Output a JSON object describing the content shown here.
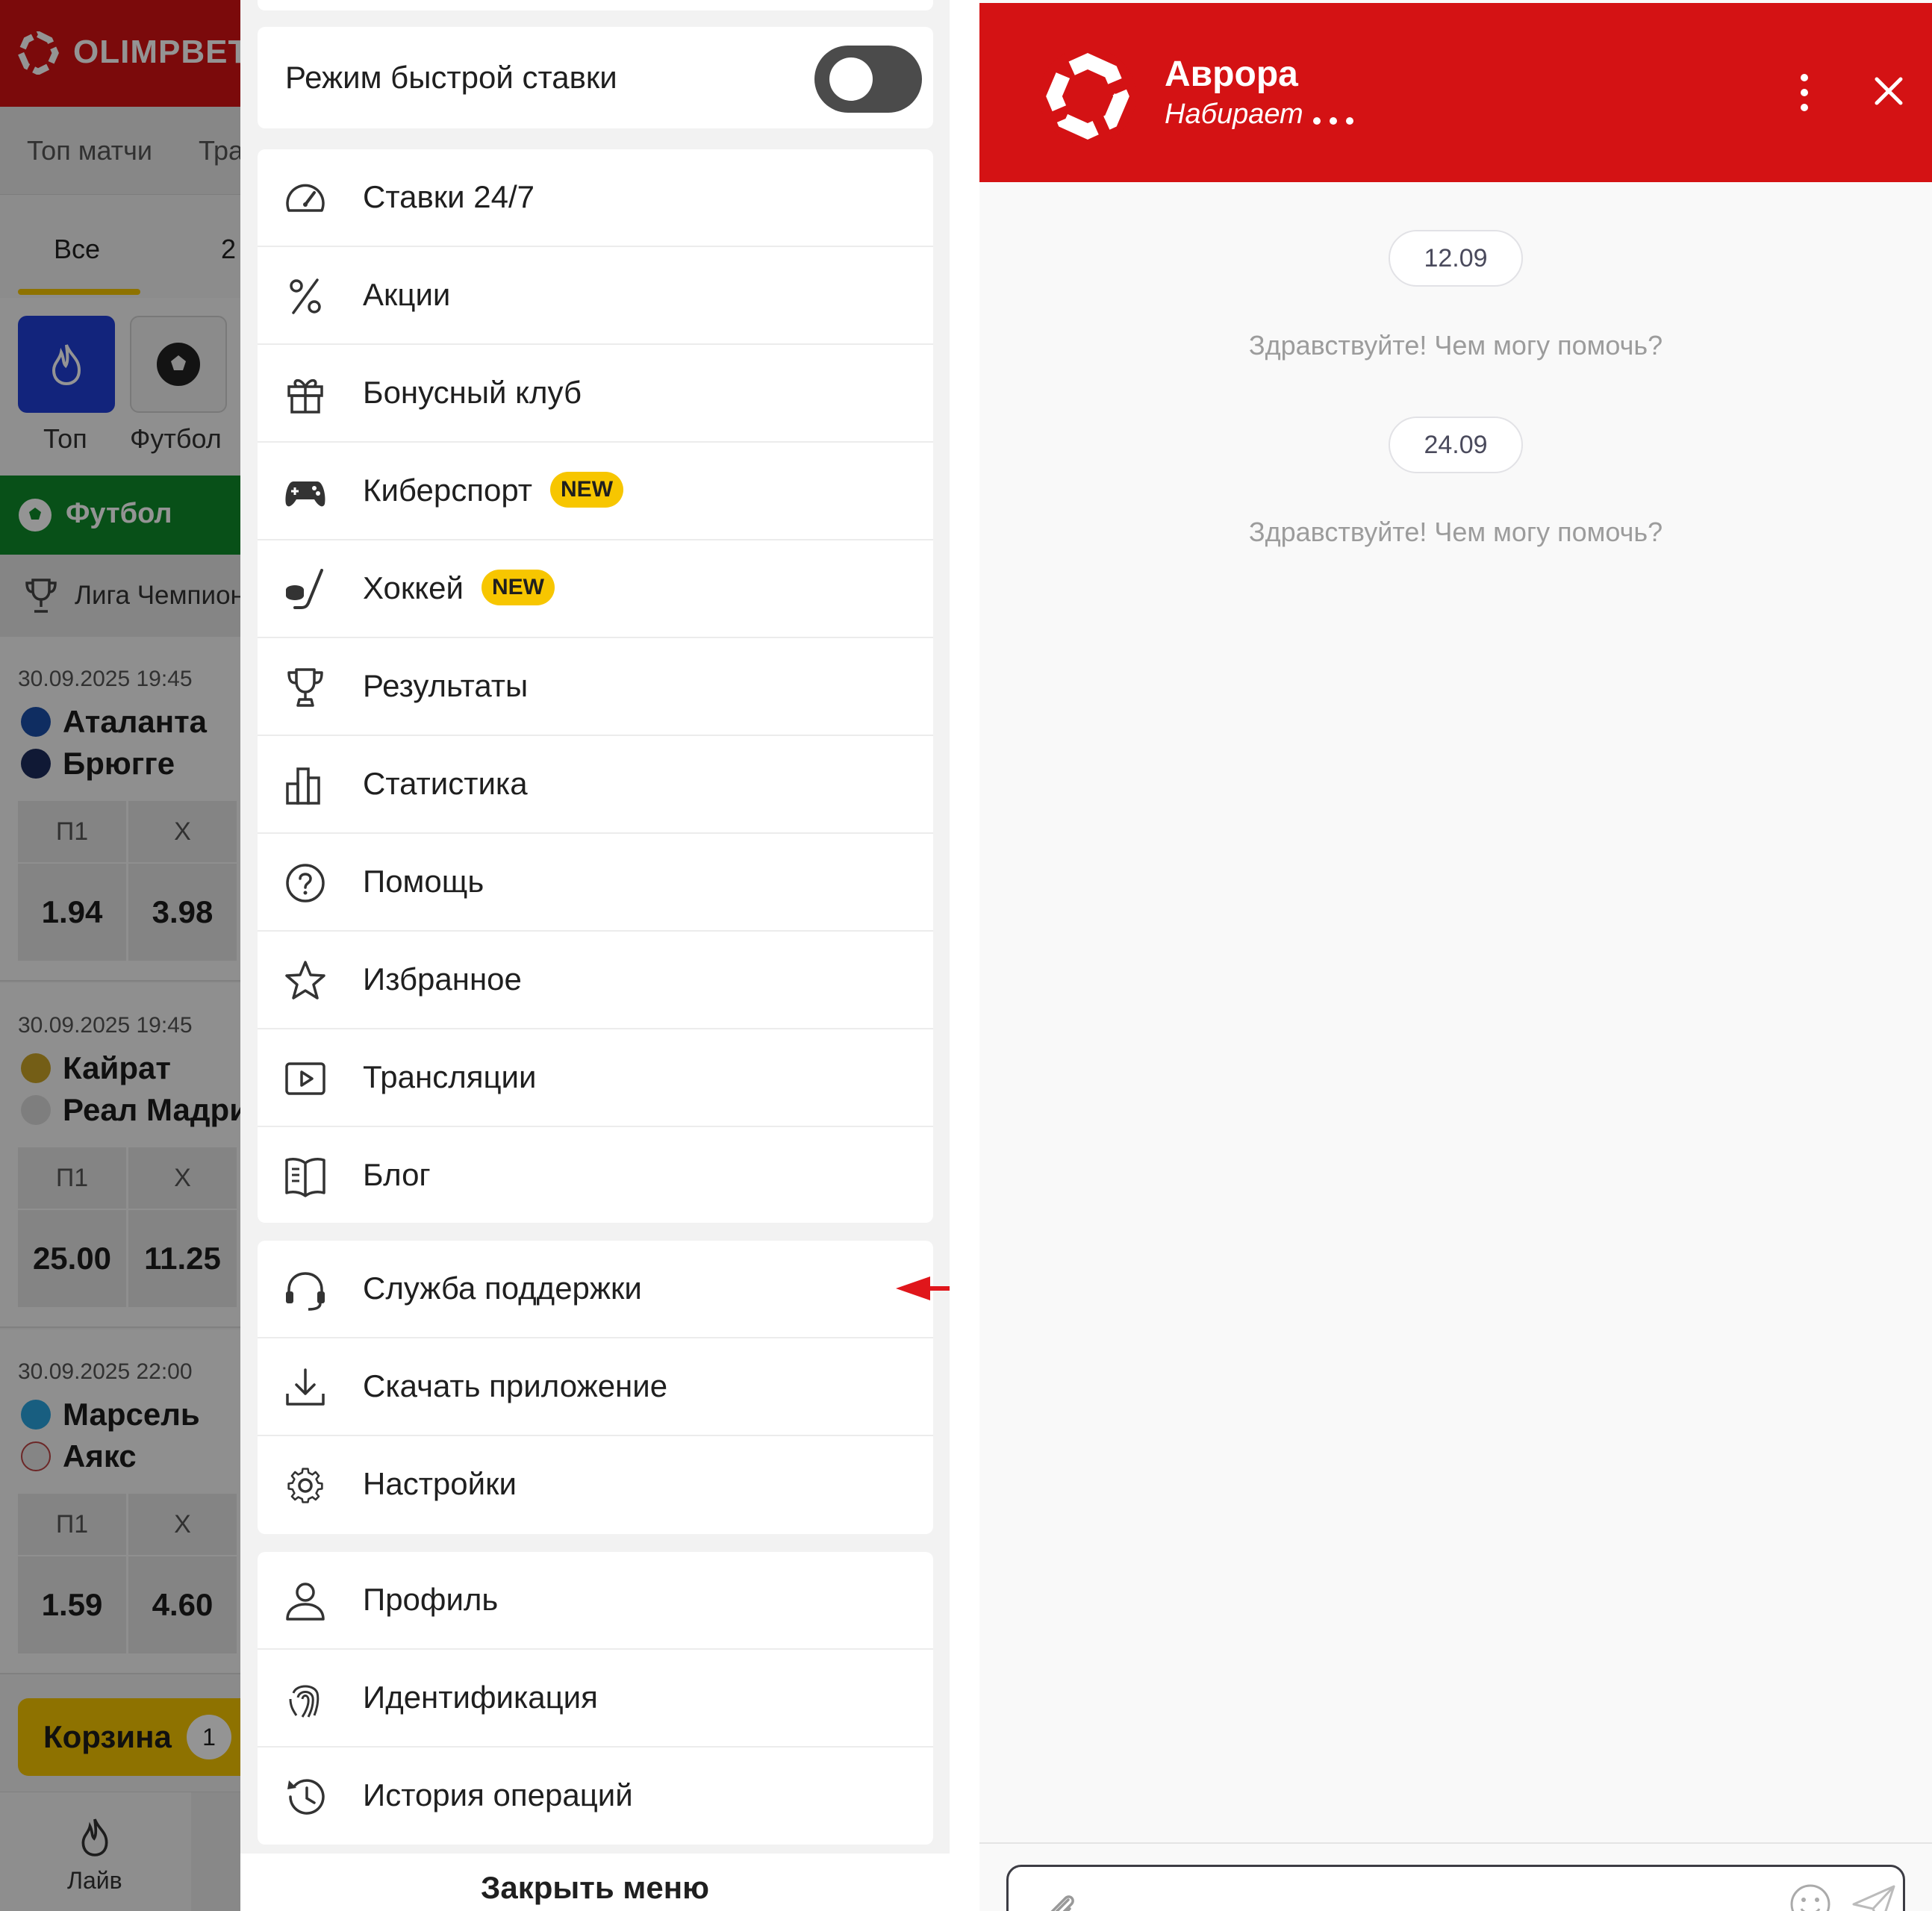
{
  "background_app": {
    "brand": "OLIMPBET",
    "subtabs": [
      "Топ матчи",
      "Трансляции"
    ],
    "categories": [
      "Все",
      "2"
    ],
    "sports": [
      {
        "label": "Топ",
        "icon": "fire-icon"
      },
      {
        "label": "Футбол",
        "icon": "soccer-ball-icon"
      }
    ],
    "section_title": "Футбол",
    "league": "Лига Чемпионов",
    "matches": [
      {
        "datetime": "30.09.2025 19:45",
        "team1": "Аталанта",
        "team2": "Брюгге",
        "odds_headers": [
          "П1",
          "X"
        ],
        "odds": [
          "1.94",
          "3.98"
        ]
      },
      {
        "datetime": "30.09.2025 19:45",
        "team1": "Кайрат",
        "team2": "Реал Мадрид",
        "odds_headers": [
          "П1",
          "X"
        ],
        "odds": [
          "25.00",
          "11.25"
        ]
      },
      {
        "datetime": "30.09.2025 22:00",
        "team1": "Марсель",
        "team2": "Аякс",
        "odds_headers": [
          "П1",
          "X"
        ],
        "odds": [
          "1.59",
          "4.60"
        ]
      }
    ],
    "basket": {
      "label": "Корзина",
      "count": "1"
    },
    "bottom_nav": {
      "live_label": "Лайв"
    }
  },
  "menu": {
    "quick_bet": {
      "label": "Режим быстрой ставки",
      "enabled": false
    },
    "group1": [
      {
        "label": "Ставки 24/7",
        "icon": "speedometer-icon"
      },
      {
        "label": "Акции",
        "icon": "percent-icon"
      },
      {
        "label": "Бонусный клуб",
        "icon": "gift-icon"
      },
      {
        "label": "Киберспорт",
        "icon": "gamepad-icon",
        "badge": "NEW"
      },
      {
        "label": "Хоккей",
        "icon": "hockey-icon",
        "badge": "NEW"
      },
      {
        "label": "Результаты",
        "icon": "trophy-icon"
      },
      {
        "label": "Статистика",
        "icon": "bar-chart-icon"
      },
      {
        "label": "Помощь",
        "icon": "help-circle-icon"
      },
      {
        "label": "Избранное",
        "icon": "star-icon"
      },
      {
        "label": "Трансляции",
        "icon": "play-icon"
      },
      {
        "label": "Блог",
        "icon": "book-icon"
      }
    ],
    "group2": [
      {
        "label": "Служба поддержки",
        "icon": "headset-icon"
      },
      {
        "label": "Скачать приложение",
        "icon": "download-icon"
      },
      {
        "label": "Настройки",
        "icon": "gear-icon"
      }
    ],
    "group3": [
      {
        "label": "Профиль",
        "icon": "user-icon"
      },
      {
        "label": "Идентификация",
        "icon": "fingerprint-icon"
      },
      {
        "label": "История операций",
        "icon": "history-icon"
      }
    ],
    "close_label": "Закрыть меню"
  },
  "chat": {
    "agent_name": "Аврора",
    "status": "Набирает",
    "messages": [
      {
        "date": "12.09",
        "text": "Здравствуйте! Чем могу помочь?"
      },
      {
        "date": "24.09",
        "text": "Здравствуйте! Чем могу помочь?"
      }
    ]
  },
  "colors": {
    "brand_red": "#d41214",
    "sport_green": "#0e8a2a",
    "accent_yellow": "#f5c500",
    "top_tile_blue": "#1f3fd6",
    "arrow_red": "#e0161b"
  }
}
